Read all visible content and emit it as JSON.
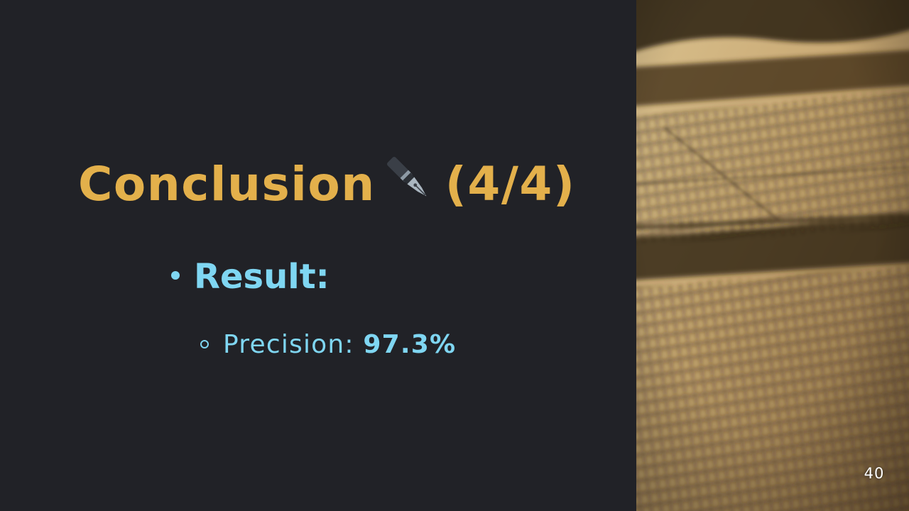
{
  "slide": {
    "title": "Conclusion",
    "title_counter": "(4/4)",
    "title_icon": "fountain-pen-icon",
    "bullets": [
      {
        "label": "Result:",
        "sub_bullets": [
          {
            "label": "Precision:",
            "value": "97.3%"
          }
        ]
      }
    ],
    "side_image": "blurred-old-newspaper-image",
    "page_number": "40"
  },
  "colors": {
    "background": "#212227",
    "title": "#e3b04b",
    "body_text": "#7fd6f2",
    "page_number": "#ffffff"
  }
}
